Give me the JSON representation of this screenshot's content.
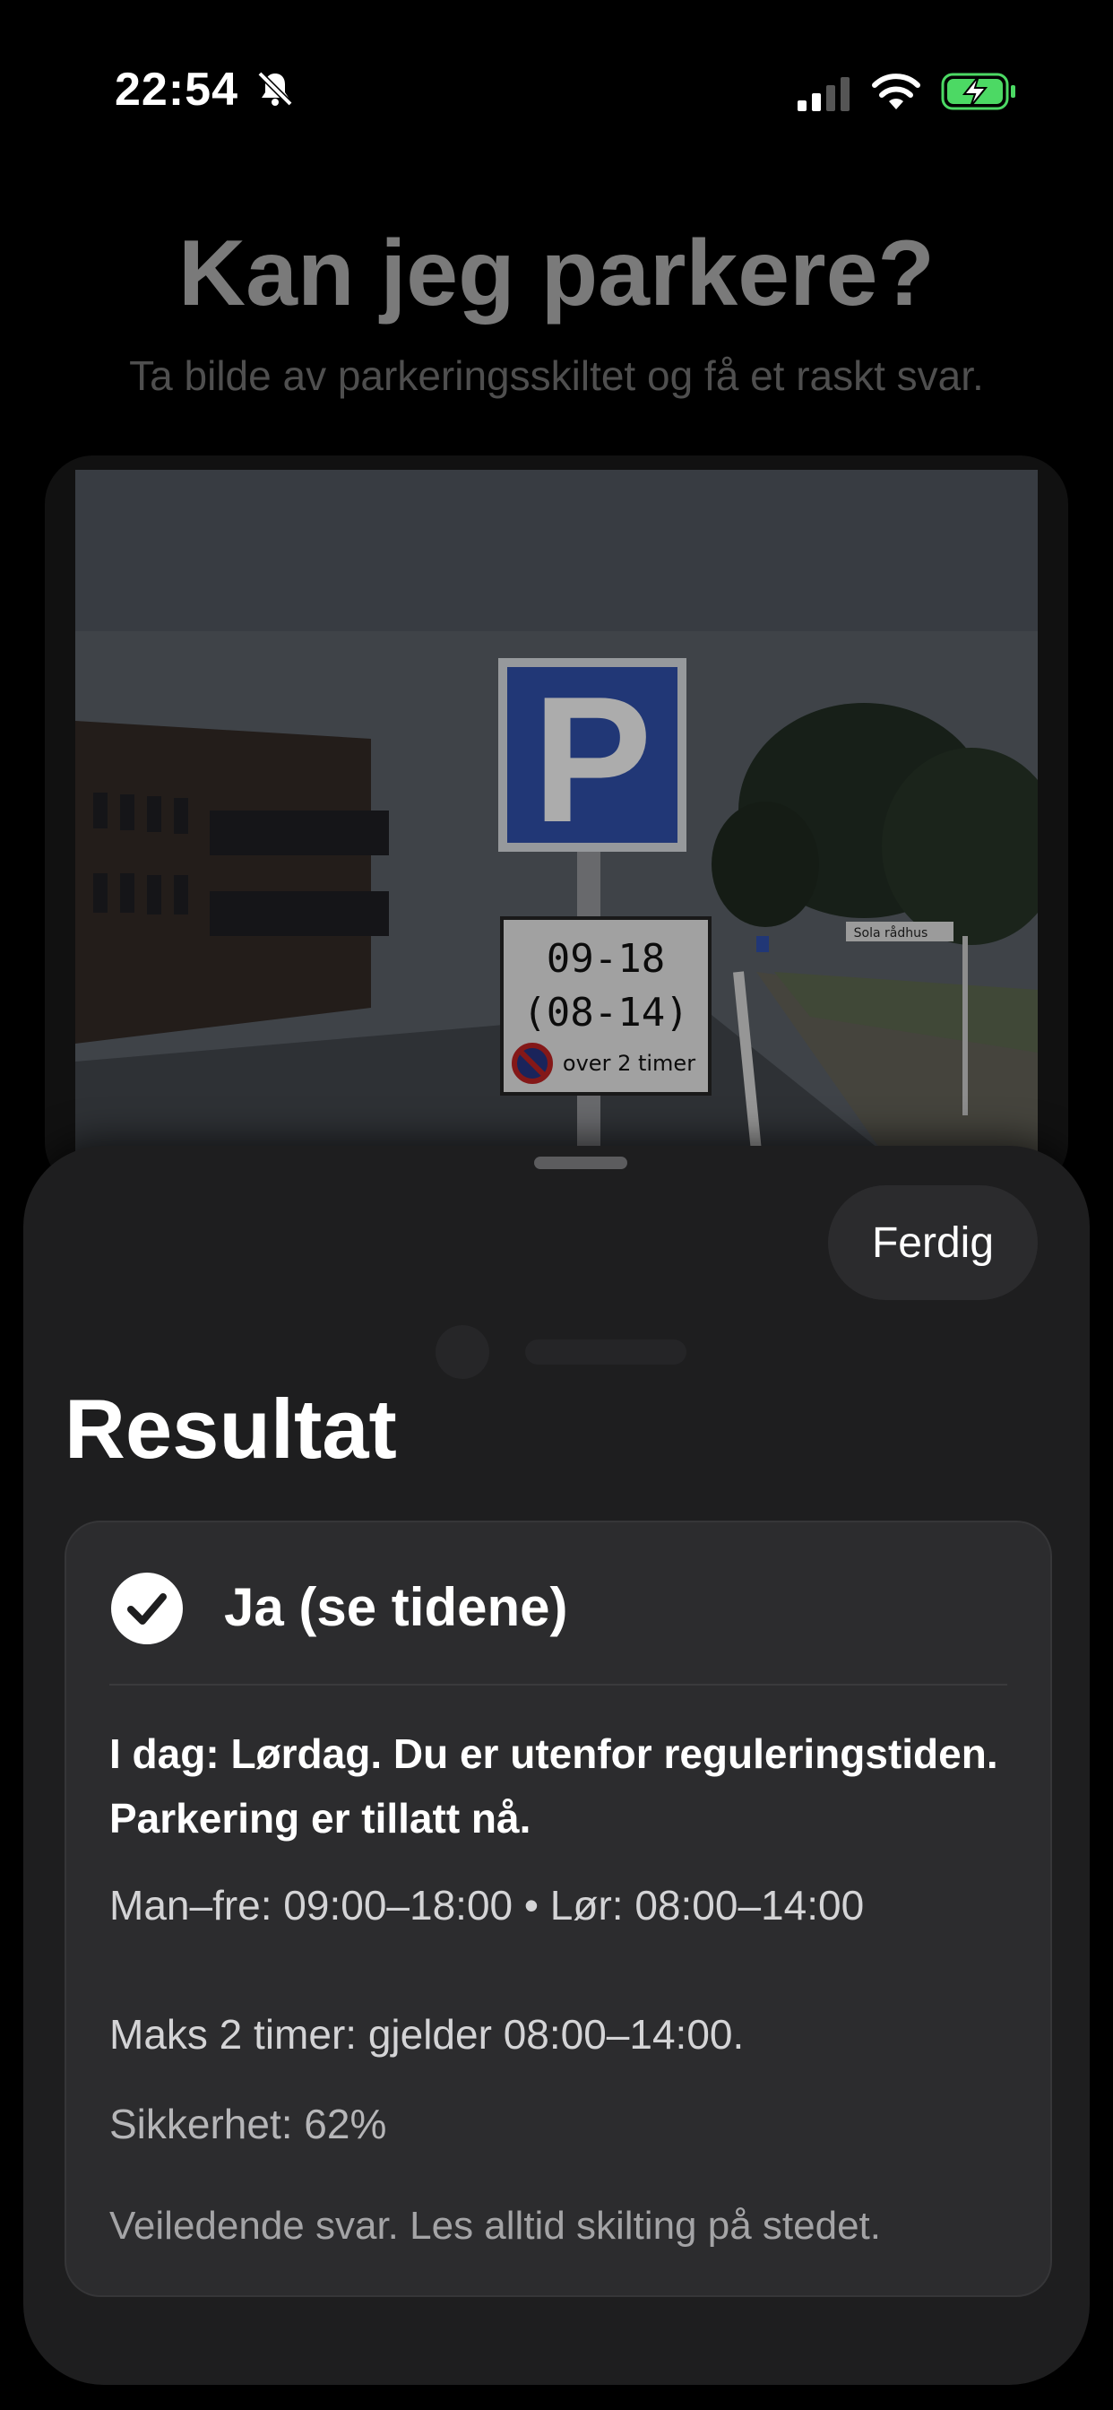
{
  "status_bar": {
    "time": "22:54",
    "icons": [
      "bell-slash-icon",
      "cellular-signal-icon",
      "wifi-icon",
      "battery-charging-icon"
    ],
    "battery_color": "#4cd964"
  },
  "main": {
    "title": "Kan jeg parkere?",
    "subtitle": "Ta bilde av parkeringsskiltet og få et raskt svar."
  },
  "photo": {
    "sign_letter": "P",
    "sign_hours": "09-18",
    "sign_saturday_hours": "(08-14)",
    "sign_limit": "over 2 timer",
    "street_sign": "Sola rådhus"
  },
  "sheet": {
    "done_label": "Ferdig",
    "title": "Resultat",
    "result": {
      "icon": "checkmark-circle-icon",
      "answer": "Ja (se tidene)",
      "explanation": "I dag: Lørdag. Du er utenfor reguleringstiden. Parkering er tillatt nå.",
      "hours": "Man–fre: 09:00–18:00 • Lør: 08:00–14:00",
      "limit": "Maks 2 timer: gjelder 08:00–14:00.",
      "confidence": "Sikkerhet: 62%",
      "disclaimer": "Veiledende svar. Les alltid skilting på stedet."
    }
  }
}
